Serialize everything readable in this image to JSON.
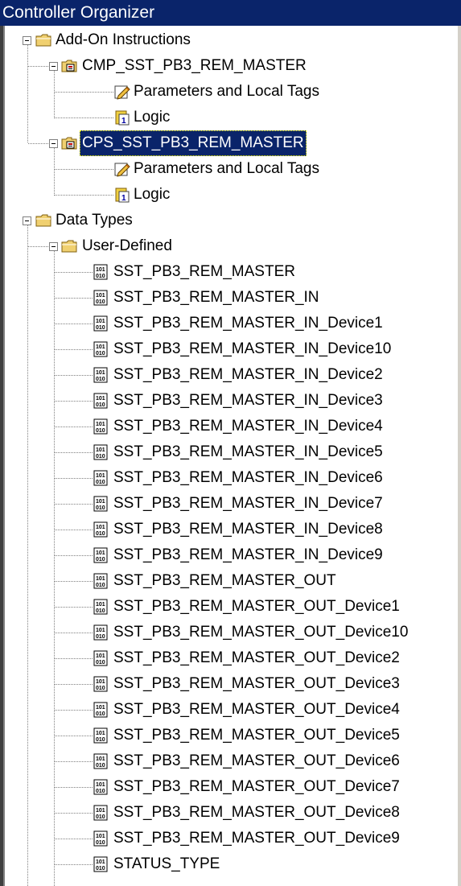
{
  "window": {
    "title": "Controller Organizer"
  },
  "tree": {
    "add_on_instructions": {
      "label": "Add-On Instructions",
      "items": [
        {
          "label": "CMP_SST_PB3_REM_MASTER",
          "children": [
            "Parameters and Local Tags",
            "Logic"
          ]
        },
        {
          "label": "CPS_SST_PB3_REM_MASTER",
          "selected": true,
          "children": [
            "Parameters and Local Tags",
            "Logic"
          ]
        }
      ]
    },
    "data_types": {
      "label": "Data Types",
      "user_defined": {
        "label": "User-Defined",
        "items": [
          "SST_PB3_REM_MASTER",
          "SST_PB3_REM_MASTER_IN",
          "SST_PB3_REM_MASTER_IN_Device1",
          "SST_PB3_REM_MASTER_IN_Device10",
          "SST_PB3_REM_MASTER_IN_Device2",
          "SST_PB3_REM_MASTER_IN_Device3",
          "SST_PB3_REM_MASTER_IN_Device4",
          "SST_PB3_REM_MASTER_IN_Device5",
          "SST_PB3_REM_MASTER_IN_Device6",
          "SST_PB3_REM_MASTER_IN_Device7",
          "SST_PB3_REM_MASTER_IN_Device8",
          "SST_PB3_REM_MASTER_IN_Device9",
          "SST_PB3_REM_MASTER_OUT",
          "SST_PB3_REM_MASTER_OUT_Device1",
          "SST_PB3_REM_MASTER_OUT_Device10",
          "SST_PB3_REM_MASTER_OUT_Device2",
          "SST_PB3_REM_MASTER_OUT_Device3",
          "SST_PB3_REM_MASTER_OUT_Device4",
          "SST_PB3_REM_MASTER_OUT_Device5",
          "SST_PB3_REM_MASTER_OUT_Device6",
          "SST_PB3_REM_MASTER_OUT_Device7",
          "SST_PB3_REM_MASTER_OUT_Device8",
          "SST_PB3_REM_MASTER_OUT_Device9",
          "STATUS_TYPE"
        ]
      }
    }
  },
  "colors": {
    "selection": "#0a246a",
    "folder": "#f0d070",
    "tree_line": "#808080"
  },
  "icons": {
    "folder": "folder-icon",
    "aoi": "add-on-instruction-icon",
    "params": "parameters-pencil-icon",
    "logic": "logic-routine-icon",
    "udt": "data-type-1010-icon",
    "expander": "collapse-minus-icon"
  }
}
